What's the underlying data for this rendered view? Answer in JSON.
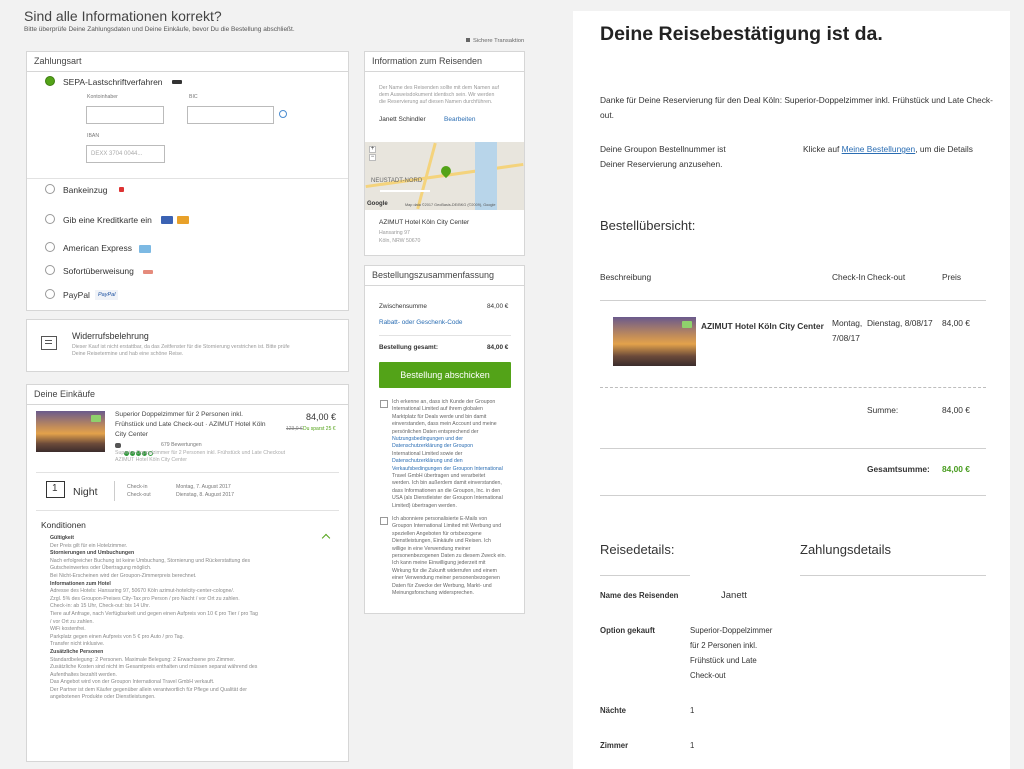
{
  "left": {
    "title": "Sind alle Informationen korrekt?",
    "subtitle": "Bitte überprüfe Deine Zahlungsdaten und Deine Einkäufe, bevor Du die Bestellung abschließt.",
    "secure": "Sichere Transaktion",
    "payment": {
      "header": "Zahlungsart",
      "sepa_label": "SEPA-Lastschriftverfahren",
      "account_holder_label": "Kontoinhaber",
      "bic_label": "BIC",
      "iban_label": "IBAN",
      "iban_placeholder": "DEXX 3704 0044...",
      "info_icon": "info-circle-icon",
      "options": [
        "Bankeinzug",
        "Gib eine Kreditkarte ein",
        "American Express",
        "Sofortüberweisung",
        "PayPal"
      ],
      "paypal_badge": "PayPal"
    },
    "withdrawal": {
      "title": "Widerrufsbelehrung",
      "text_1": "Dieser Kauf ist nicht erstattbar, da das Zeitfenster für die Stornierung verstrichen ist. Bitte prüfe",
      "text_2": "Deine Reisetermine und hab eine schöne Reise."
    },
    "purchases": {
      "header": "Deine Einkäufe",
      "deal_title_1": "Superior Doppelzimmer für 2 Personen inkl.",
      "deal_title_2": "Frühstück und Late Check-out · AZIMUT Hotel Köln",
      "deal_title_3": "City Center",
      "price": "84,00 €",
      "old_price": "123,0 €",
      "saving": "Du sparst 25 €",
      "reviews": "679 Bewertungen",
      "desc_1": "Superior-Doppelzimmer für 2 Personen inkl. Frühstück und Late Checkout",
      "desc_2": "AZIMUT Hotel Köln City Center",
      "nights_value": "1",
      "nights_label": "Night",
      "checkin_label": "Check-in",
      "checkout_label": "Check-out",
      "checkin_date": "Montag, 7. August 2017",
      "checkout_date": "Dienstag, 8. August 2017"
    },
    "conditions": {
      "title": "Konditionen",
      "lines": [
        {
          "text": "Gültigkeit",
          "style": "strong"
        },
        {
          "text": "Der Preis gilt für ein Hotelzimmer.",
          "style": "plain"
        },
        {
          "text": "Stornierungen und Umbuchungen",
          "style": "strong"
        },
        {
          "text": "Nach erfolgreicher Buchung ist keine Umbuchung, Stornierung und Rückerstattung des",
          "style": "plain"
        },
        {
          "text": "Gutscheinwertes oder Übertragung möglich.",
          "style": "plain"
        },
        {
          "text": "Bei Nicht-Erscheinen wird der Groupon-Zimmerpreis berechnet.",
          "style": "plain"
        },
        {
          "text": "Informationen zum Hotel",
          "style": "strong"
        },
        {
          "text": "Adresse des Hotels: Hansaring 97, 50670 Köln azimut-hotelcity-center-cologne/.",
          "style": "plain"
        },
        {
          "text": "Zzgl. 5% des Groupon-Preises City-Tax pro Person / pro Nacht / vor Ort zu zahlen.",
          "style": "plain"
        },
        {
          "text": "Check-in: ab 15 Uhr, Check-out: bis 14 Uhr.",
          "style": "plain"
        },
        {
          "text": "Tiere auf Anfrage, nach Verfügbarkeit und gegen einen Aufpreis von 10 € pro Tier / pro Tag",
          "style": "plain"
        },
        {
          "text": "/ vor Ort zu zahlen.",
          "style": "plain"
        },
        {
          "text": "WiFi kostenfrei.",
          "style": "plain"
        },
        {
          "text": "Parkplatz gegen einen Aufpreis von 5 € pro Auto / pro Tag.",
          "style": "plain"
        },
        {
          "text": "Transfer nicht inklusive.",
          "style": "plain"
        },
        {
          "text": "Zusätzliche Personen",
          "style": "strong"
        },
        {
          "text": "Standardbelegung: 2 Personen. Maximale Belegung: 2 Erwachsene pro Zimmer.",
          "style": "plain"
        },
        {
          "text": "Zusätzliche Kosten sind nicht im Gesamtpreis enthalten und müssen separat während des",
          "style": "plain"
        },
        {
          "text": "Aufenthaltes bezahlt werden.",
          "style": "plain"
        },
        {
          "text": "Das Angebot wird von der Groupon International Travel GmbH verkauft.",
          "style": "plain"
        },
        {
          "text": "Der Partner ist dem Käufer gegenüber allein verantwortlich für Pflege und Qualität der",
          "style": "plain"
        },
        {
          "text": "angebotenen Produkte oder Dienstleistungen.",
          "style": "plain"
        }
      ]
    },
    "traveler_info": {
      "header": "Information zum Reisenden",
      "note_1": "Der Name des Reisenden sollte mit dem Namen auf",
      "note_2": "dem Ausweisdokument identisch sein. Wir werden",
      "note_3": "die Reservierung auf diesen Namen durchführen.",
      "name": "Janett Schindler",
      "edit": "Bearbeiten",
      "map_label": "NEUSTADT-NORD",
      "map_brand": "Google",
      "map_credit": "Map data ©2017 GeoBasis-DE/BKG (©2009), Google",
      "hotel_name": "AZIMUT Hotel Köln City Center",
      "address_1": "Hansaring 97",
      "address_2": "Köln, NRW 50670"
    },
    "order_summary": {
      "header": "Bestellungszusammenfassung",
      "subtotal_label": "Zwischensumme",
      "subtotal_value": "84,00 €",
      "coupon_link": "Rabatt- oder Geschenk-Code",
      "total_label": "Bestellung gesamt:",
      "total_value": "84,00 €",
      "submit": "Bestellung abschicken",
      "consent_1": [
        "Ich erkenne an, dass ich Kunde der Groupon",
        "International Limited auf ihrem globalen",
        "Marktplatz für Deals werde und bin damit",
        "einverstanden, dass mein Account und meine",
        "persönlichen Daten entsprechend der",
        "Nutzungsbedingungen und der",
        "Datenschutzerklärung der Groupon",
        "International Limited sowie der",
        "Datenschutzerklärung und den",
        "Verkaufsbedingungen der Groupon International",
        "Travel GmbH übertragen und verarbeitet",
        "werden. Ich bin außerdem damit einverstanden,",
        "dass Informationen an die Groupon, Inc. in den",
        "USA (als Dienstleister der Groupon International",
        "Limited) übertragen werden."
      ],
      "consent_2": [
        "Ich abonniere personalisierte E-Mails von",
        "Groupon International Limited mit Werbung und",
        "speziellen Angeboten für ortsbezogene",
        "Dienstleistungen, Einkäufe und Reisen. Ich",
        "willige in eine Verwendung meiner",
        "personenbezogenen Daten zu diesem Zweck ein.",
        "Ich kann meine Einwilligung jederzeit mit",
        "Wirkung für die Zukunft widerrufen und einem",
        "einer Verwendung meiner personenbezogenen",
        "Daten für Zwecke der Werbung, Markt- und",
        "Meinungsforschung widersprechen."
      ]
    }
  },
  "right": {
    "title": "Deine Reisebestätigung ist da.",
    "thanks_1": "Danke für Deine Reservierung für den Deal Köln: Superior-Doppelzimmer inkl. Frühstück und Late Check-",
    "thanks_2": "out.",
    "order_num_1": "Deine Groupon Bestellnummer ist",
    "order_num_2": "Deiner Reservierung anzusehen.",
    "klicke_pre": "Klicke auf ",
    "klicke_link": "Meine Bestellungen",
    "klicke_post": ", um die Details",
    "overview_title": "Bestellübersicht:",
    "col_desc": "Beschreibung",
    "col_checkin": "Check-In",
    "col_checkout": "Check-out",
    "col_price": "Preis",
    "row_hotel": "AZIMUT Hotel Köln City Center",
    "row_checkin_1": "Montag,",
    "row_checkin_2": "7/08/17",
    "row_checkout": "Dienstag, 8/08/17",
    "row_price": "84,00 €",
    "sum_label": "Summe:",
    "sum_value": "84,00 €",
    "total_label": "Gesamtsumme:",
    "total_value": "84,00 €",
    "travel_details": "Reisedetails:",
    "payment_details": "Zahlungsdetails",
    "traveler_label": "Name des Reisenden",
    "traveler_value": "Janett",
    "option_label": "Option gekauft",
    "option_1": "Superior-Doppelzimmer",
    "option_2": "für 2 Personen inkl.",
    "option_3": "Frühstück und Late",
    "option_4": "Check-out",
    "nights_label": "Nächte",
    "nights_value": "1",
    "rooms_label": "Zimmer",
    "rooms_value": "1"
  },
  "colors": {
    "accent_green": "#53a318",
    "link_blue": "#2a6db3",
    "total_green": "#4a9d21"
  }
}
